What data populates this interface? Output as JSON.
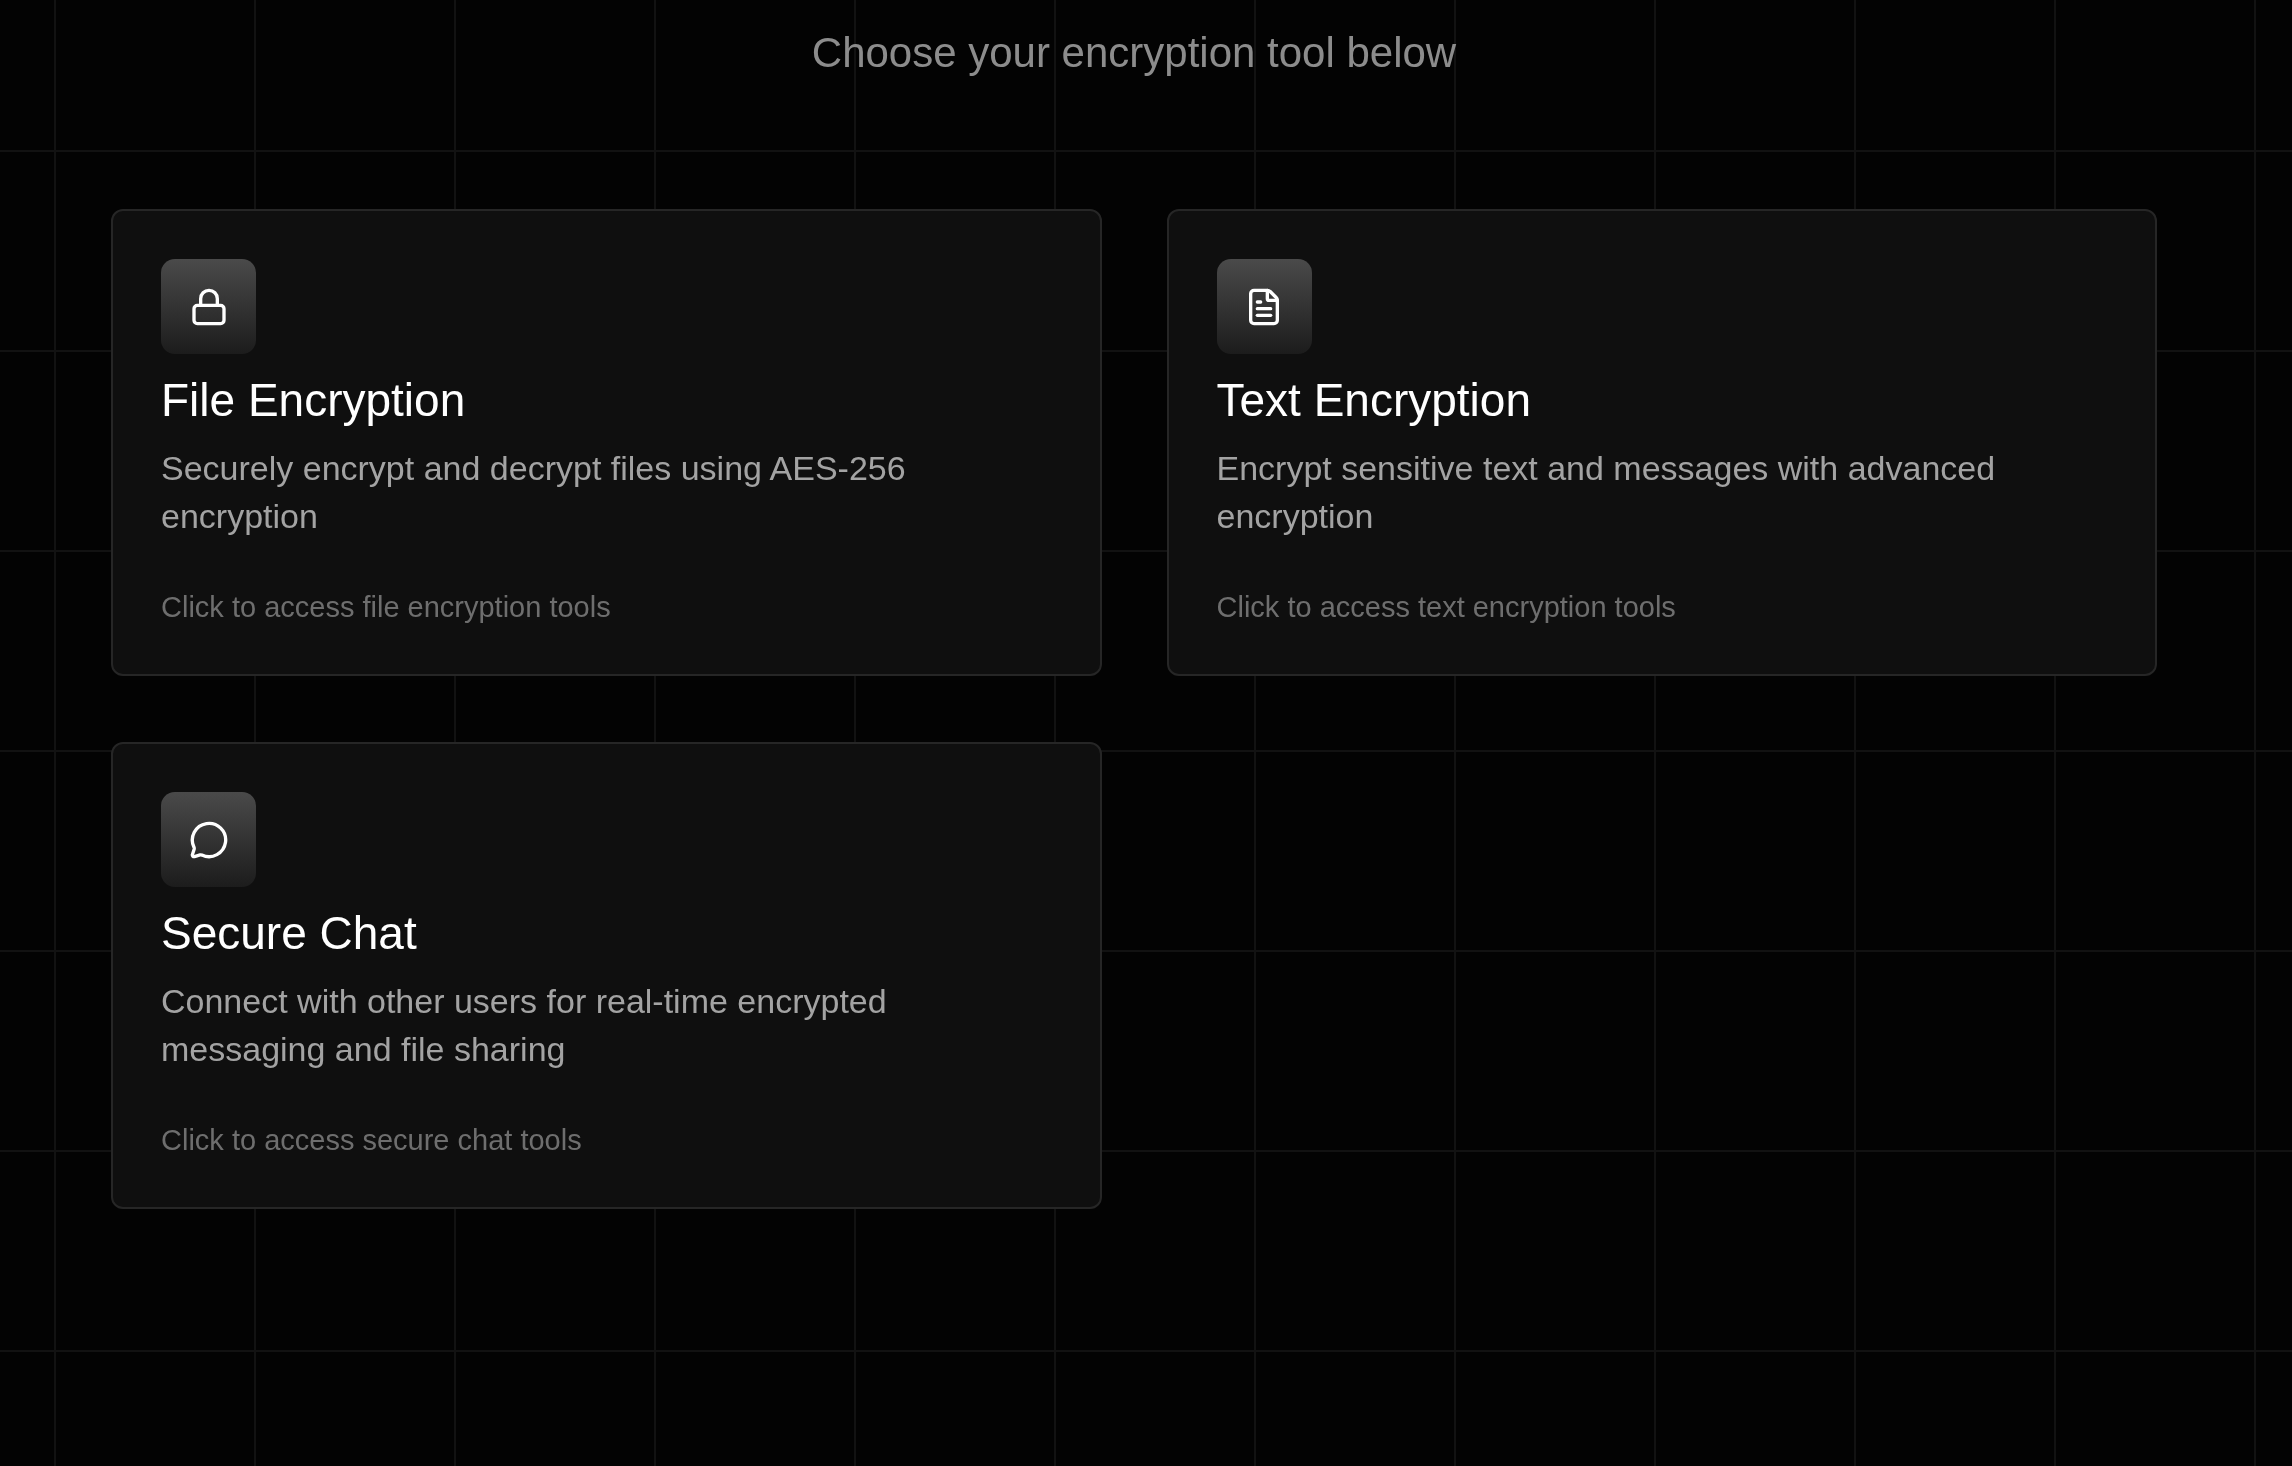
{
  "subtitle": "Choose your encryption tool below",
  "tools": [
    {
      "kind": "file",
      "title": "File Encryption",
      "description": "Securely encrypt and decrypt files using AES-256 encryption",
      "hint": "Click to access file encryption tools"
    },
    {
      "kind": "text",
      "title": "Text Encryption",
      "description": "Encrypt sensitive text and messages with advanced encryption",
      "hint": "Click to access text encryption tools"
    },
    {
      "kind": "chat",
      "title": "Secure Chat",
      "description": "Connect with other users for real-time encrypted messaging and file sharing",
      "hint": "Click to access secure chat tools"
    }
  ]
}
